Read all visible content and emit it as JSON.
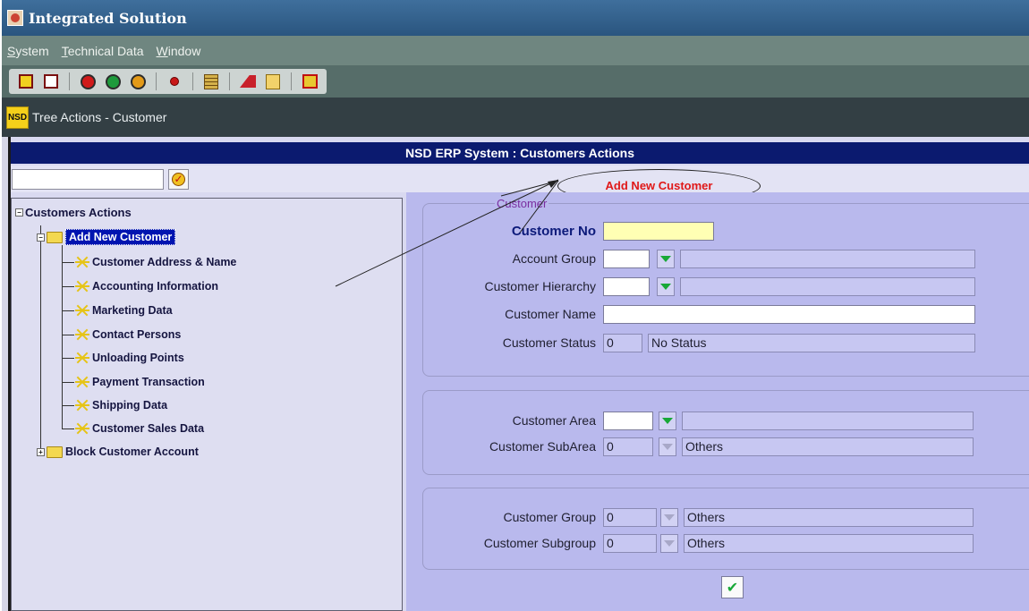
{
  "window": {
    "title": "Integrated Solution"
  },
  "menu": {
    "items": [
      "System",
      "Technical Data",
      "Window"
    ]
  },
  "toolbar": {
    "icons": [
      "save-icon",
      "print-icon",
      "record-red-icon",
      "record-green-icon",
      "record-orange-icon",
      "stop-icon",
      "list-icon",
      "edit-icon",
      "document-icon",
      "exit-icon"
    ]
  },
  "subwindow": {
    "logo": "NSD",
    "title": "Tree Actions - Customer"
  },
  "header": {
    "title": "NSD ERP System : Customers Actions"
  },
  "annotation": {
    "label": "Add New Customer"
  },
  "tree": {
    "root": "Customers Actions",
    "selected": "Add New Customer",
    "children": [
      "Customer Address & Name",
      "Accounting Information",
      "Marketing Data",
      "Contact Persons",
      "Unloading Points",
      "Payment Transaction",
      "Shipping Data",
      "Customer Sales Data"
    ],
    "collapsed": "Block Customer Account"
  },
  "form": {
    "group1_legend": "Customer",
    "customer_no_label": "Customer No",
    "customer_no_value": "",
    "account_group_label": "Account Group",
    "customer_hierarchy_label": "Customer Hierarchy",
    "customer_name_label": "Customer Name",
    "customer_status_label": "Customer Status",
    "customer_status_code": "0",
    "customer_status_text": "No Status",
    "customer_area_label": "Customer Area",
    "customer_subarea_label": "Customer SubArea",
    "customer_subarea_code": "0",
    "customer_subarea_text": "Others",
    "customer_group_label": "Customer Group",
    "customer_group_code": "0",
    "customer_group_text": "Others",
    "customer_subgroup_label": "Customer Subgroup",
    "customer_subgroup_code": "0",
    "customer_subgroup_text": "Others"
  },
  "colors": {
    "header_bg": "#0b1a6f",
    "selection_bg": "#0014b0",
    "form_bg": "#b9b9ed",
    "annotation_text": "#e01818"
  }
}
